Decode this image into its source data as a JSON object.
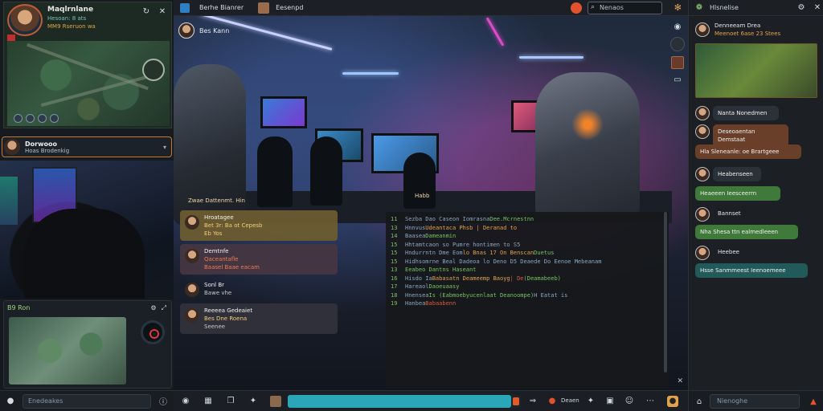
{
  "left": {
    "player": {
      "name": "Maqlrnlane",
      "stat_line1": "Hesoan: 8 ats",
      "stat_line2": "MM9 Rseruon wa"
    },
    "streamer": {
      "name": "Dorwooo",
      "subtitle": "Hoas Brodenkig"
    },
    "map_panel": {
      "title": "B9 Ron"
    },
    "input_placeholder": "Enedeakes"
  },
  "topbar": {
    "title": "Berhe Bianrer",
    "user": "Eesenpd",
    "search_placeholder": "Nenaos"
  },
  "stage": {
    "host_name": "Bes Kann",
    "caption_left": "Zwae Dattenmt. Hin",
    "caption_center": "Habb"
  },
  "chat_bubbles": [
    {
      "name": "Hroatagee",
      "line1": "Bet 3r: Ba ot Cepesb",
      "line2": "Eb Yos",
      "style": "gold"
    },
    {
      "name": "Demtnfe",
      "line1": "Qaceantafle",
      "line2": "Baasel Baae eacam",
      "style": "mauve"
    },
    {
      "name": "Sonl Br",
      "line1": "",
      "line2": "Bawe vhe",
      "style": "dark"
    },
    {
      "name": "Reeeea Gedeaiet",
      "line1": "Bes Dne Roena",
      "line2": "Seenee",
      "style": "dark"
    }
  ],
  "code_lines": [
    {
      "n": "11",
      "parts": [
        {
          "t": "Sezba Dao Caseon Iomrasna ",
          "c": "c1"
        },
        {
          "t": "Dee.Mcrnestnn",
          "c": "c3"
        }
      ]
    },
    {
      "n": "13",
      "parts": [
        {
          "t": "Hnnvus ",
          "c": "c1"
        },
        {
          "t": "Udeantaca Phsb | Deranad to",
          "c": "c2"
        }
      ]
    },
    {
      "n": "14",
      "parts": [
        {
          "t": "Baasea ",
          "c": "c1"
        },
        {
          "t": "Dameanmin",
          "c": "c3"
        }
      ]
    },
    {
      "n": "15",
      "parts": [
        {
          "t": "Hhtamtcaon so Pumre hontimen to S5",
          "c": "c1"
        }
      ]
    },
    {
      "n": "15",
      "parts": [
        {
          "t": "Hndurrntn Dme Eom ",
          "c": "c1"
        },
        {
          "t": "lo Bnas 17 On Benscan ",
          "c": "c2"
        },
        {
          "t": "Duetus",
          "c": "c3"
        }
      ]
    },
    {
      "n": "15",
      "parts": [
        {
          "t": "Hidhsomrne Beal Dadeoa lo Deno D5 Deaede Do Eenoe Mebeanam",
          "c": "c1"
        }
      ]
    },
    {
      "n": "13",
      "parts": [
        {
          "t": "Eeabeo Dantns Haseant",
          "c": "c3"
        }
      ]
    },
    {
      "n": "16",
      "parts": [
        {
          "t": "Hisdo Ia ",
          "c": "c1"
        },
        {
          "t": "Babasatn Deameemp Baoyg",
          "c": "c2"
        },
        {
          "t": " | De ",
          "c": "c4"
        },
        {
          "t": "(Deamabeeb)",
          "c": "c3"
        }
      ]
    },
    {
      "n": "17",
      "parts": [
        {
          "t": "Hareaol ",
          "c": "c1"
        },
        {
          "t": "Daoeuaasy",
          "c": "c3"
        }
      ]
    },
    {
      "n": "18",
      "parts": [
        {
          "t": "Hnensea ",
          "c": "c1"
        },
        {
          "t": "Is (Eabmoebyucenlaat Deanoompe) ",
          "c": "c3"
        },
        {
          "t": "H Eatat is",
          "c": "c1"
        }
      ]
    },
    {
      "n": "19",
      "parts": [
        {
          "t": "Hanbea ",
          "c": "c1"
        },
        {
          "t": "Babaabenn",
          "c": "c4"
        }
      ]
    }
  ],
  "center_bottom": {
    "button_label": "Deaen",
    "progress": 0.96
  },
  "right": {
    "header": "Hlsnelise",
    "input_placeholder": "Nienoghe",
    "messages": [
      {
        "name": "Denneeam Drea",
        "sub": "Meenoet 6ase 23 Stees",
        "style": "none"
      },
      {
        "name": "Nanta Nonedmen",
        "sub": "",
        "style": "none"
      },
      {
        "name": "",
        "sub": "Deseoaentan Demstaat",
        "style": "brown"
      },
      {
        "name": "",
        "sub": "Hla Sleneanle: oe Brartgeee",
        "style": "brown"
      },
      {
        "name": "",
        "sub": "Heabenseen",
        "style": "dark"
      },
      {
        "name": "",
        "sub": "Heaeeen   Ieesceerrn",
        "style": "green"
      },
      {
        "name": "Bannset",
        "sub": "",
        "style": "none"
      },
      {
        "name": "",
        "sub": "Nha Shesa ttn ealmedleeen",
        "style": "green"
      },
      {
        "name": "Heebee",
        "sub": "",
        "style": "none"
      },
      {
        "name": "",
        "sub": "Hsse Sanmmeest Ieenoemeee",
        "style": "teal"
      }
    ]
  },
  "colors": {
    "accent": "#2aa6b8",
    "alert": "#e2522f",
    "highlight": "#e2a24a"
  }
}
